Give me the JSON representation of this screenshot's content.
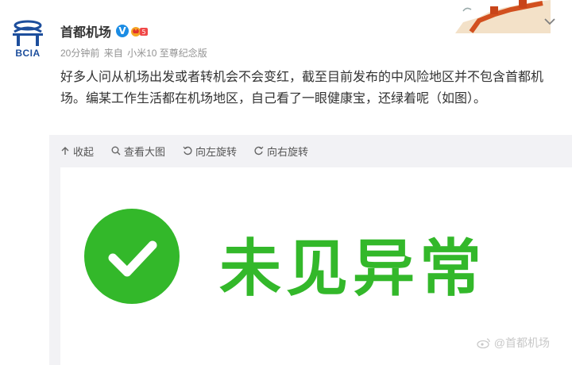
{
  "post": {
    "author": {
      "name": "首都机场",
      "avatar_text": "BCIA",
      "avatar_icon": "airport-logo-icon",
      "verified_icon": "verified-v-icon",
      "member_icon": "member-crown-badge-icon"
    },
    "meta": {
      "time": "20分钟前",
      "source_prefix": "来自",
      "source": "小米10 至尊纪念版"
    },
    "text": "好多人问从机场出发或者转机会不会变红，截至目前发布的中风险地区并不包含首都机场。编某工作生活都在机场地区，自己看了一眼健康宝，还绿着呢（如图）。"
  },
  "media_toolbar": {
    "collapse": "收起",
    "view_large": "查看大图",
    "rotate_left": "向左旋转",
    "rotate_right": "向右旋转"
  },
  "image": {
    "status_text": "未见异常",
    "status_color": "#33b82a",
    "watermark": "@首都机场"
  },
  "colors": {
    "meta_gray": "#939393",
    "verified_blue": "#1b8ce4",
    "media_bg": "#f2f2f5",
    "green": "#33b82a"
  }
}
